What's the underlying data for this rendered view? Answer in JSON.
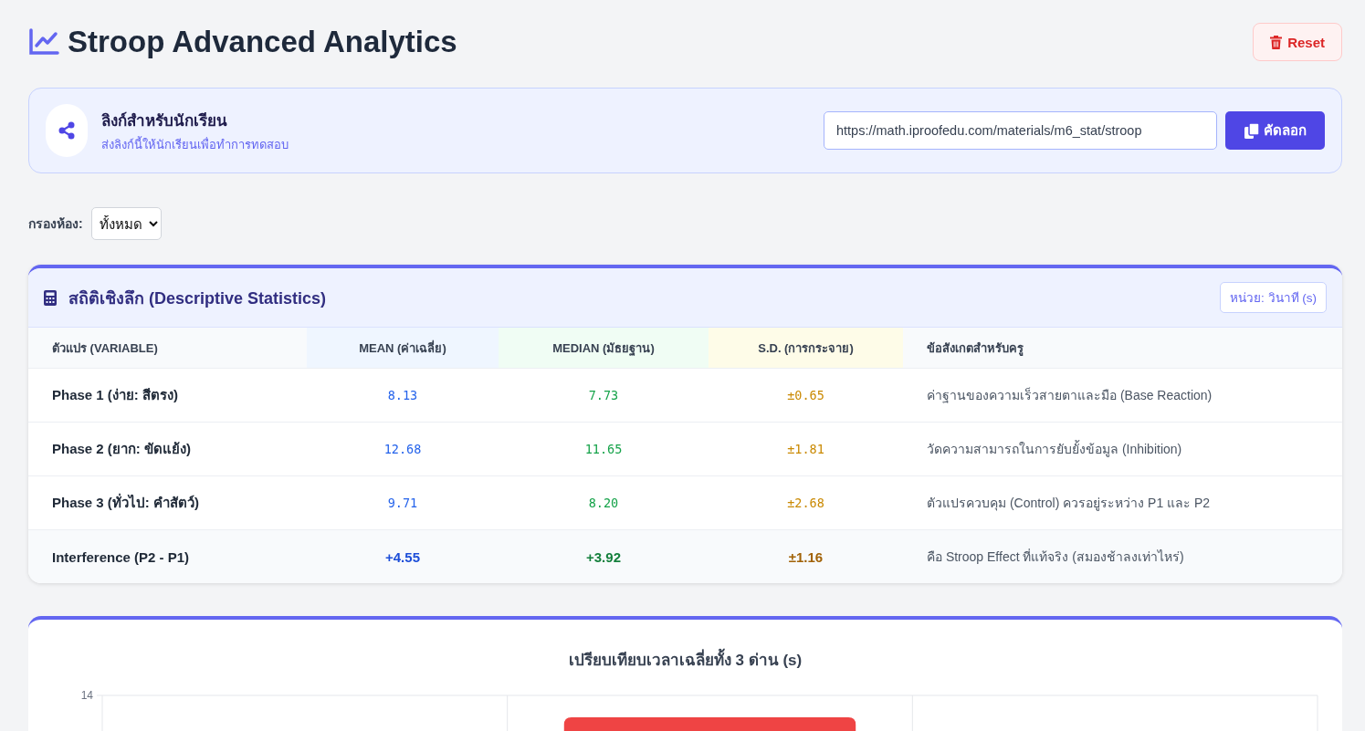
{
  "header": {
    "title": "Stroop Advanced Analytics",
    "reset_button": "Reset"
  },
  "share": {
    "title": "ลิงก์สำหรับนักเรียน",
    "subtitle": "ส่งลิงก์นี้ให้นักเรียนเพื่อทำการทดสอบ",
    "link_value": "https://math.iproofedu.com/materials/m6_stat/stroop",
    "copy_button": "คัดลอก"
  },
  "filter": {
    "label": "กรองห้อง:",
    "value": "ทั้งหมด"
  },
  "stats": {
    "title": "สถิติเชิงลึก (Descriptive Statistics)",
    "unit_badge": "หน่วย: วินาที (s)",
    "columns": [
      "ตัวแปร (VARIABLE)",
      "MEAN (ค่าเฉลี่ย)",
      "MEDIAN (มัธยฐาน)",
      "S.D. (การกระจาย)",
      "ข้อสังเกตสำหรับครู"
    ],
    "rows": [
      {
        "kind": "phase",
        "variable": "Phase 1 (ง่าย: สีตรง)",
        "mean": "8.13",
        "median": "7.73",
        "sd": "±0.65",
        "note": "ค่าฐานของความเร็วสายตาและมือ (Base Reaction)"
      },
      {
        "kind": "phase",
        "variable": "Phase 2 (ยาก: ขัดแย้ง)",
        "mean": "12.68",
        "median": "11.65",
        "sd": "±1.81",
        "note": "วัดความสามารถในการยับยั้งข้อมูล (Inhibition)"
      },
      {
        "kind": "phase",
        "variable": "Phase 3 (ทั่วไป: คำสัตว์)",
        "mean": "9.71",
        "median": "8.20",
        "sd": "±2.68",
        "note": "ตัวแปรควบคุม (Control) ควรอยู่ระหว่าง P1 และ P2"
      },
      {
        "kind": "summary",
        "variable": "Interference (P2 - P1)",
        "mean": "+4.55",
        "median": "+3.92",
        "sd": "±1.16",
        "note": "คือ Stroop Effect ที่แท้จริง (สมองช้าลงเท่าไหร่)"
      }
    ]
  },
  "chart": {
    "title": "เปรียบเทียบเวลาเฉลี่ยทั้ง 3 ด่าน (s)",
    "y_axis_labels": [
      "14"
    ]
  }
}
